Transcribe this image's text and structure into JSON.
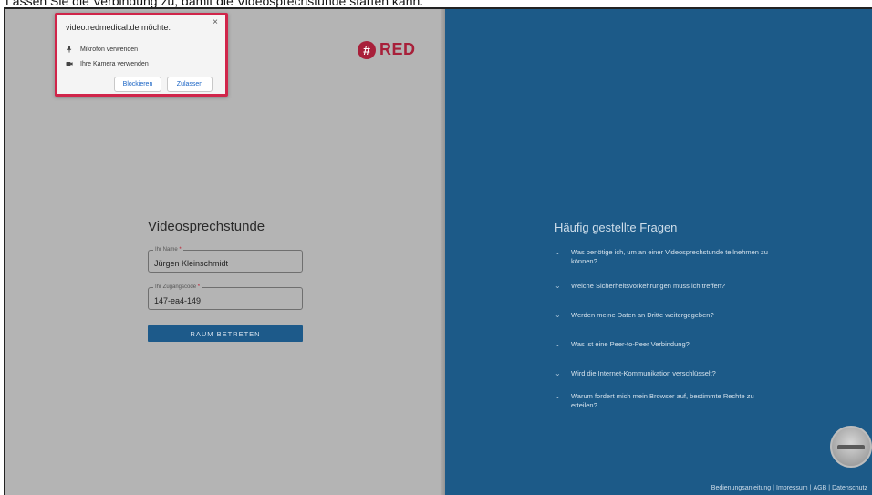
{
  "caption": "Lassen Sie die Verbindung zu, damit die Videosprechstunde starten kann.",
  "permission_popup": {
    "title": "video.redmedical.de möchte:",
    "close_glyph": "×",
    "mic_label": "Mikrofon verwenden",
    "mic_icon": "microphone-icon",
    "camera_label": "Ihre Kamera verwenden",
    "camera_icon": "camera-icon",
    "block_label": "Blockieren",
    "allow_label": "Zulassen",
    "highlight_color": "#d0254a"
  },
  "logo": {
    "badge_glyph": "#",
    "text": "RED",
    "color": "#a8203a"
  },
  "form": {
    "title": "Videosprechstunde",
    "name_label": "Ihr Name",
    "name_value": "Jürgen Kleinschmidt",
    "code_label": "Ihr Zugangscode",
    "code_value": "147-ea4-149",
    "required_mark": "*",
    "submit_label": "RAUM BETRETEN"
  },
  "faq": {
    "title": "Häufig gestellte Fragen",
    "items": [
      {
        "text": "Was benötige ich, um an einer Videosprechstunde teilnehmen zu können?"
      },
      {
        "text": "Welche Sicherheitsvorkehrungen muss ich treffen?"
      },
      {
        "text": "Werden meine Daten an Dritte weitergegeben?"
      },
      {
        "text": "Was ist eine Peer-to-Peer Verbindung?"
      },
      {
        "text": "Wird die Internet-Kommunikation verschlüsselt?"
      },
      {
        "text": "Warum fordert mich mein Browser auf, bestimmte Rechte zu erteilen?"
      }
    ],
    "chevron_glyph": "⌄"
  },
  "footer": {
    "links": [
      "Bedienungsanleitung",
      "Impressum",
      "AGB",
      "Datenschutz"
    ],
    "separator": "|"
  },
  "colors": {
    "left_bg": "#b4b4b4",
    "right_bg": "#1c5a88",
    "button_bg": "#1d5a8a"
  }
}
